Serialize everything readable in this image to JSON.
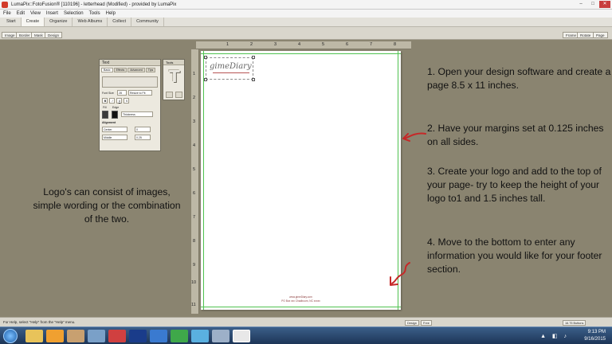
{
  "window": {
    "title": "LumaPix::FotoFusion® [110196] - letterhead (Modified) - provided by LumaPix",
    "minimize": "–",
    "maximize": "□",
    "close": "✕"
  },
  "menu": [
    "File",
    "Edit",
    "View",
    "Insert",
    "Selection",
    "Tools",
    "Help"
  ],
  "tabs": [
    "Start",
    "Create",
    "Organize",
    "Web Albums",
    "Collect",
    "Community"
  ],
  "toolbar": {
    "left_buttons": [
      "Image",
      "Border",
      "Mask",
      "Design"
    ],
    "right_buttons": [
      "Frame",
      "Rotate",
      "Page"
    ]
  },
  "ruler_top": [
    "1",
    "2",
    "3",
    "4",
    "5",
    "6",
    "7",
    "8"
  ],
  "ruler_left": [
    "1",
    "2",
    "3",
    "4",
    "5",
    "6",
    "7",
    "8",
    "9",
    "10",
    "11"
  ],
  "page": {
    "logo_text": "gimeDiary",
    "footer_line1": "www.gimeDiary.com",
    "footer_line2": "PO Box xxx  Chadbourn, NC xxxxx"
  },
  "text_panel": {
    "title": "Text",
    "tabs": [
      "Basic",
      "Effects",
      "Advanced",
      "Tips"
    ],
    "font_size_label": "Font Size",
    "font_size_value": "28",
    "fit_value": "Resize to Fit",
    "style_buttons": [
      "B",
      "I",
      "U",
      "S"
    ],
    "fill_label": "Fill",
    "edge_label": "Edge",
    "thickness_value": "Thickness",
    "alignment_label": "Alignment",
    "align_h": "Center",
    "align_v": "Middle",
    "spacing_1": "0",
    "spacing_2": "0.25"
  },
  "tool_panel": {
    "title": "Tools",
    "t_glyph": "T"
  },
  "instructions": [
    "1. Open your design software and create a page 8.5 x 11 inches.",
    "2. Have your margins set at 0.125 inches on all sides.",
    "3. Create your logo and add to the top of your page- try to keep the height of your logo to1 and 1.5 inches tall.",
    "4. Move to the bottom to enter any information you would like for your footer section."
  ],
  "left_note": "Logo's can consist of images, simple wording or the combination of the two.",
  "statusbar": {
    "help": "For Help, select \"Help\" from the \"Help\" menu.",
    "box1": "Design",
    "box2": "Free",
    "box3": "16.75 Buttons"
  },
  "taskbar": {
    "time": "9:13 PM",
    "date": "9/16/2015"
  },
  "colors": {
    "workspace": "#8a8470",
    "margin_guide": "#4fc24f",
    "arrow": "#c62828"
  }
}
